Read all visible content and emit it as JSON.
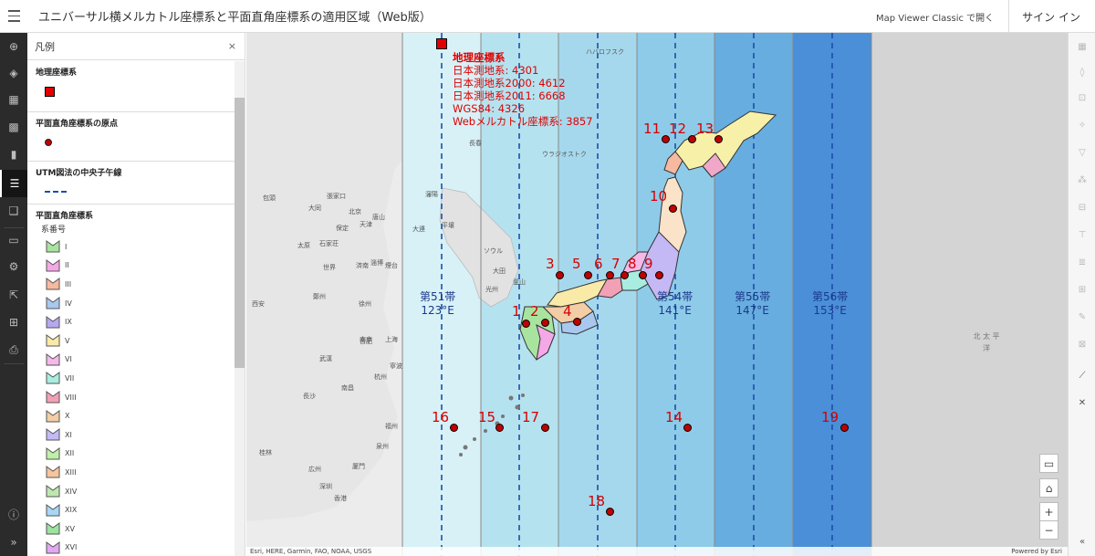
{
  "header": {
    "title": "ユニバーサル横メルカトル座標系と平面直角座標系の適用区域（Web版）",
    "open_classic": "Map Viewer Classic で開く",
    "sign_in": "サイン イン"
  },
  "legend": {
    "title": "凡例",
    "geo_title": "地理座標系",
    "origin_title": "平面直角座標系の原点",
    "meridian_title": "UTM図法の中央子午線",
    "planar_title": "平面直角座標系",
    "system_label": "系番号",
    "items": [
      {
        "label": "I",
        "color": "#a9e3a0"
      },
      {
        "label": "II",
        "color": "#f5a8e8"
      },
      {
        "label": "III",
        "color": "#f7b9a0"
      },
      {
        "label": "IV",
        "color": "#a8c8ef"
      },
      {
        "label": "IX",
        "color": "#b5a8ef"
      },
      {
        "label": "V",
        "color": "#f9eaa8"
      },
      {
        "label": "VI",
        "color": "#f4b9e9"
      },
      {
        "label": "VII",
        "color": "#a8ede0"
      },
      {
        "label": "VIII",
        "color": "#f2a0b5"
      },
      {
        "label": "X",
        "color": "#f3cda6"
      },
      {
        "label": "XI",
        "color": "#c4b9f5"
      },
      {
        "label": "XII",
        "color": "#bff0a8"
      },
      {
        "label": "XIII",
        "color": "#f6c59c"
      },
      {
        "label": "XIV",
        "color": "#bde8b0"
      },
      {
        "label": "XIX",
        "color": "#a8d6f5"
      },
      {
        "label": "XV",
        "color": "#9ce3a0"
      },
      {
        "label": "XVI",
        "color": "#e0a8f0"
      }
    ]
  },
  "map": {
    "geo_info": {
      "title": "地理座標系",
      "lines": [
        "日本測地系: 4301",
        "日本測地系2000: 4612",
        "日本測地系2011: 6668",
        "WGS84: 4326",
        "Webメルカトル座標系: 3857"
      ]
    },
    "zones": [
      {
        "name": "第51帯",
        "lon": "123°E"
      },
      {
        "name": "第54帯",
        "lon": "141°E"
      },
      {
        "name": "第55帯",
        "lon": "147°E"
      },
      {
        "name": "第56帯",
        "lon": "153°E"
      }
    ],
    "points": [
      "1",
      "2",
      "3",
      "4",
      "5",
      "6",
      "7",
      "8",
      "9",
      "10",
      "11",
      "12",
      "13",
      "14",
      "15",
      "16",
      "17",
      "18",
      "19"
    ],
    "cities": [
      "包頭",
      "張家口",
      "北京",
      "大同",
      "唐山",
      "保定",
      "天津",
      "太原",
      "石家荘",
      "世界",
      "済南",
      "淄博",
      "煙台",
      "鄭州",
      "西安",
      "徐州",
      "南京",
      "上海",
      "寧波",
      "武漢",
      "合肥",
      "長沙",
      "南昌",
      "杭州",
      "福州",
      "広州",
      "深圳",
      "厦門",
      "泉州",
      "桂林",
      "香港",
      "ソウル",
      "大田",
      "光州",
      "釜山",
      "ハバロフスク",
      "ウラジオストク",
      "長春",
      "瀋陽",
      "大連",
      "平壌"
    ],
    "ocean": "北 太 平 洋",
    "attribution_left": "Esri, HERE, Garmin, FAO, NOAA, USGS",
    "attribution_right": "Powered by Esri"
  },
  "colors": {
    "marker_red": "#c00000",
    "zone_dark": "#4a90d9",
    "label_red": "#d40000"
  }
}
